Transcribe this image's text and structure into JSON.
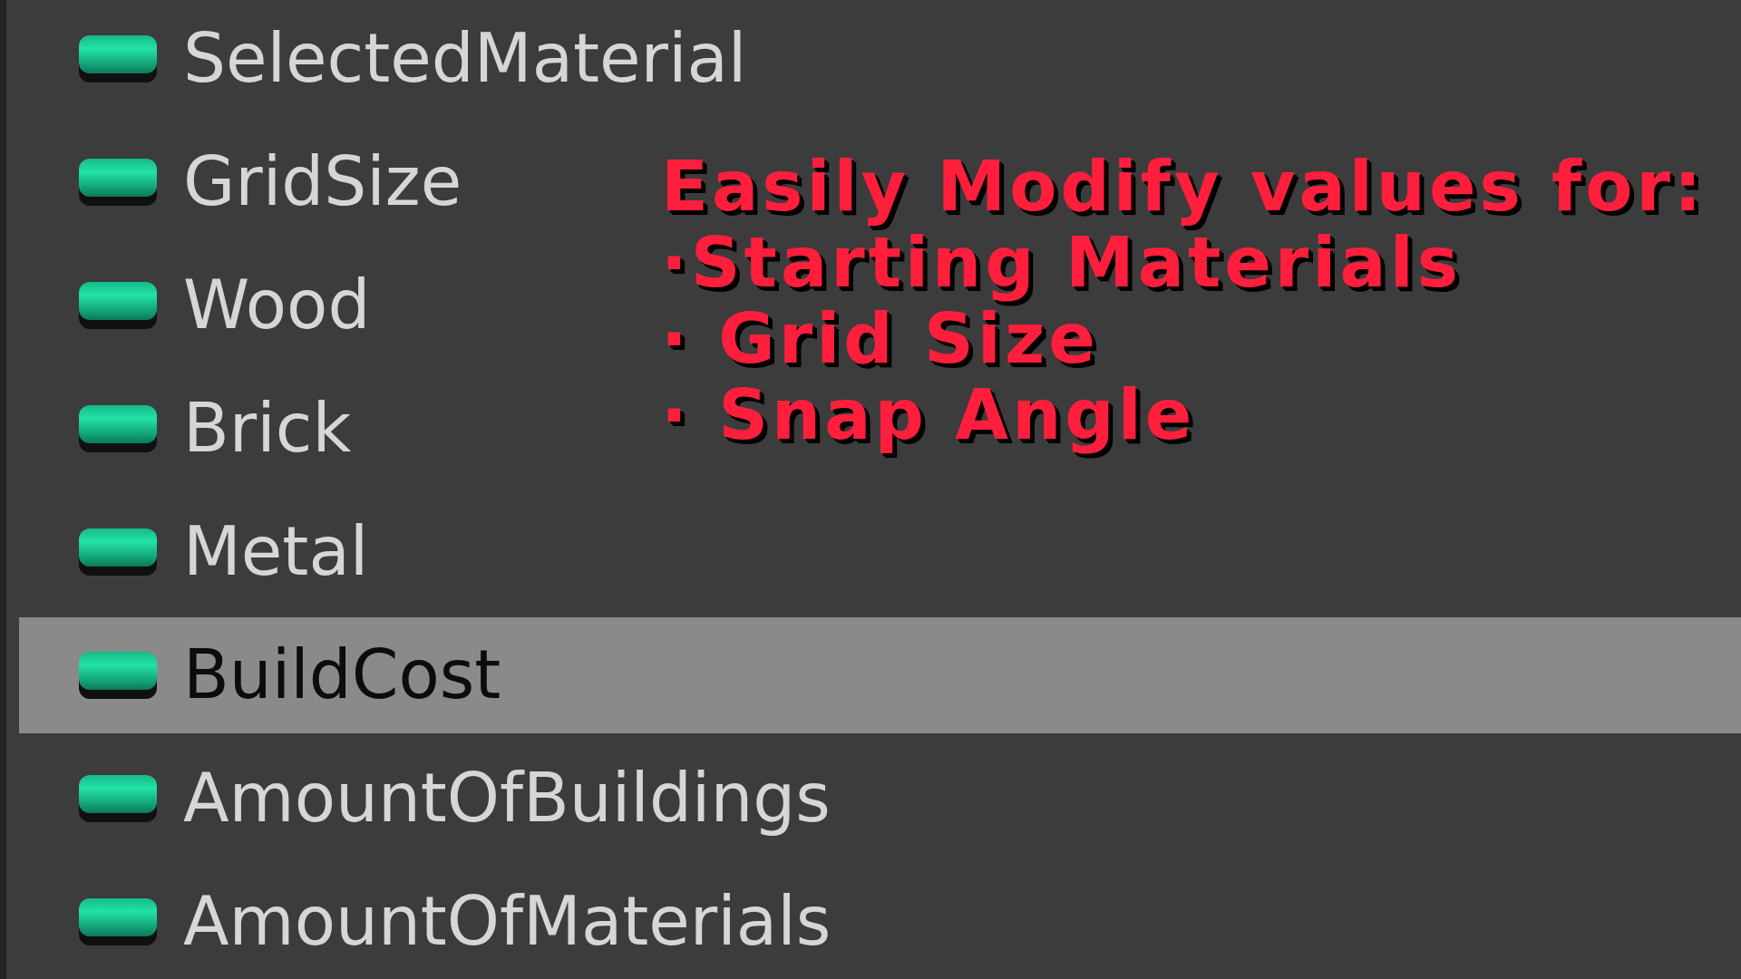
{
  "variables": [
    {
      "name": "SelectedMaterial",
      "selected": false
    },
    {
      "name": "GridSize",
      "selected": false
    },
    {
      "name": "Wood",
      "selected": false
    },
    {
      "name": "Brick",
      "selected": false
    },
    {
      "name": "Metal",
      "selected": false
    },
    {
      "name": "BuildCost",
      "selected": true
    },
    {
      "name": "AmountOfBuildings",
      "selected": false
    },
    {
      "name": "AmountOfMaterials",
      "selected": false
    }
  ],
  "annotation": {
    "title": "Easily Modify values for:",
    "bullets": [
      "·Starting Materials",
      "· Grid Size",
      "· Snap Angle"
    ]
  }
}
